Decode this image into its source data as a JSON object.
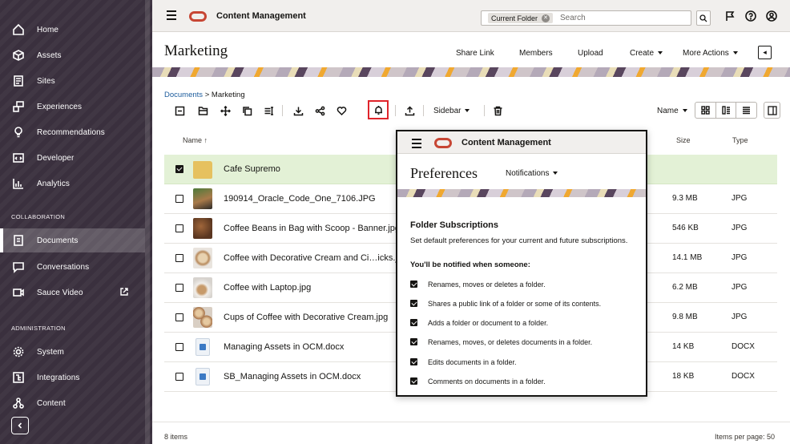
{
  "app": {
    "title": "Content Management"
  },
  "sidebar": {
    "items": [
      {
        "label": "Home",
        "icon": "home-icon"
      },
      {
        "label": "Assets",
        "icon": "assets-icon"
      },
      {
        "label": "Sites",
        "icon": "sites-icon"
      },
      {
        "label": "Experiences",
        "icon": "experiences-icon"
      },
      {
        "label": "Recommendations",
        "icon": "recommendations-icon"
      },
      {
        "label": "Developer",
        "icon": "developer-icon"
      },
      {
        "label": "Analytics",
        "icon": "analytics-icon"
      }
    ],
    "collab_label": "COLLABORATION",
    "collab_items": [
      {
        "label": "Documents",
        "icon": "documents-icon",
        "active": true
      },
      {
        "label": "Conversations",
        "icon": "conversations-icon"
      },
      {
        "label": "Sauce Video",
        "icon": "video-icon"
      }
    ],
    "admin_label": "ADMINISTRATION",
    "admin_items": [
      {
        "label": "System",
        "icon": "system-icon"
      },
      {
        "label": "Integrations",
        "icon": "integrations-icon"
      },
      {
        "label": "Content",
        "icon": "content-icon"
      }
    ]
  },
  "search": {
    "scope": "Current Folder",
    "placeholder": "Search"
  },
  "header": {
    "title": "Marketing",
    "share_link": "Share Link",
    "members": "Members",
    "upload": "Upload",
    "create": "Create",
    "more_actions": "More Actions"
  },
  "breadcrumb": {
    "root": "Documents",
    "sep": ">",
    "current": "Marketing"
  },
  "toolbar": {
    "sidebar": "Sidebar",
    "sort": "Name"
  },
  "columns": {
    "name": "Name",
    "name_sort": "↑",
    "size": "Size",
    "type": "Type"
  },
  "files": [
    {
      "name": "Cafe Supremo",
      "size": "",
      "type": "",
      "kind": "folder",
      "selected": true
    },
    {
      "name": "190914_Oracle_Code_One_7106.JPG",
      "size": "9.3 MB",
      "type": "JPG",
      "kind": "photo"
    },
    {
      "name": "Coffee Beans in Bag with Scoop - Banner.jpg",
      "size": "546 KB",
      "type": "JPG",
      "kind": "photo"
    },
    {
      "name": "Coffee with Decorative Cream and Ci…icks.jpg",
      "size": "14.1 MB",
      "type": "JPG",
      "kind": "photo"
    },
    {
      "name": "Coffee with Laptop.jpg",
      "size": "6.2 MB",
      "type": "JPG",
      "kind": "photo"
    },
    {
      "name": "Cups of Coffee with Decorative Cream.jpg",
      "size": "9.8 MB",
      "type": "JPG",
      "kind": "photo"
    },
    {
      "name": "Managing Assets in OCM.docx",
      "size": "14 KB",
      "type": "DOCX",
      "kind": "doc"
    },
    {
      "name": "SB_Managing Assets in OCM.docx",
      "size": "18 KB",
      "type": "DOCX",
      "kind": "doc"
    }
  ],
  "footer": {
    "count": "8 items",
    "per_page": "Items per page: 50"
  },
  "popup": {
    "app_title": "Content Management",
    "title": "Preferences",
    "tab": "Notifications",
    "heading": "Folder Subscriptions",
    "description": "Set default preferences for your current and future subscriptions.",
    "subheading": "You'll be notified when someone:",
    "options": [
      {
        "label": "Renames, moves or deletes a folder.",
        "checked": true
      },
      {
        "label": "Shares a public link of a folder or some of its contents.",
        "checked": true
      },
      {
        "label": "Adds a folder or document to a folder.",
        "checked": true
      },
      {
        "label": "Renames, moves, or deletes documents in a folder.",
        "checked": true
      },
      {
        "label": "Edits documents in a folder.",
        "checked": true
      },
      {
        "label": "Comments on documents in a folder.",
        "checked": true
      }
    ]
  },
  "colors": {
    "sidebar_bg": "#3c3240",
    "brand": "#c74634",
    "selected_row": "#e3f1d6",
    "highlight": "#e0242b"
  }
}
